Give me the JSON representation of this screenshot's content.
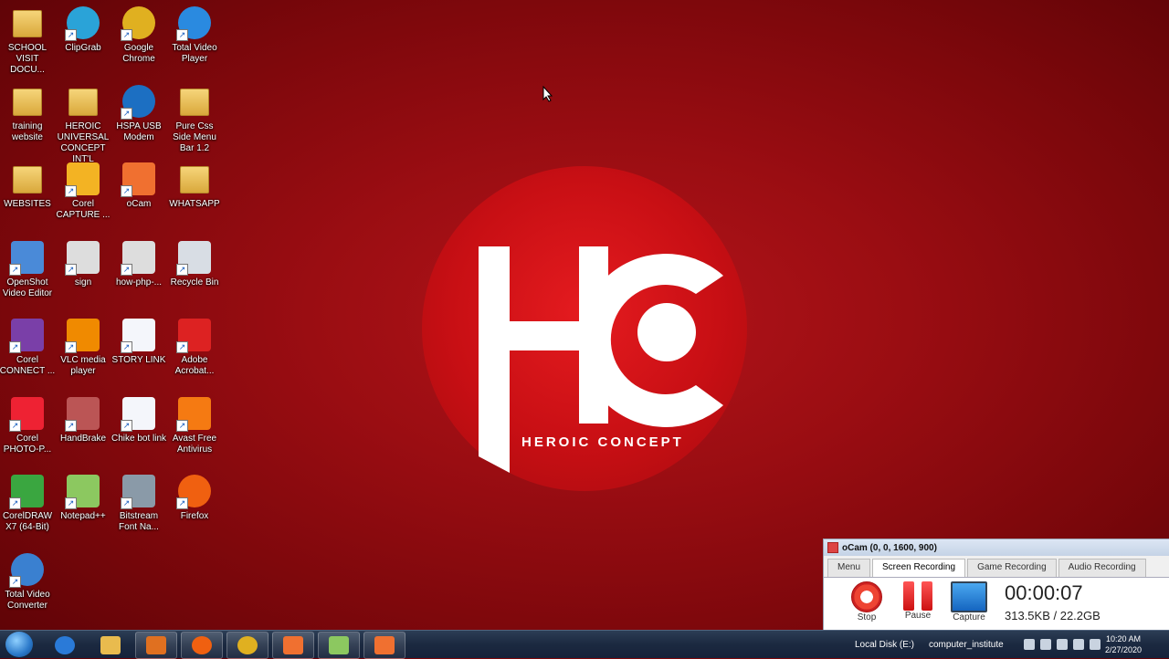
{
  "desktop_icons": [
    {
      "label": "SCHOOL VISIT DOCU...",
      "icon": "folder-icon"
    },
    {
      "label": "ClipGrab",
      "icon": "clipgrab-icon"
    },
    {
      "label": "Google Chrome",
      "icon": "chrome-icon"
    },
    {
      "label": "Total Video Player",
      "icon": "video-player-icon"
    },
    {
      "label": "training website",
      "icon": "folder-icon"
    },
    {
      "label": "HEROIC UNIVERSAL CONCEPT INT'L",
      "icon": "folder-icon"
    },
    {
      "label": "HSPA USB Modem",
      "icon": "globe-icon"
    },
    {
      "label": "Pure Css Side Menu Bar 1.2",
      "icon": "folder-icon"
    },
    {
      "label": "WEBSITES",
      "icon": "folder-icon"
    },
    {
      "label": "Corel CAPTURE ...",
      "icon": "corel-capture-icon"
    },
    {
      "label": "oCam",
      "icon": "ocam-icon"
    },
    {
      "label": "WHATSAPP",
      "icon": "folder-icon"
    },
    {
      "label": "OpenShot Video Editor",
      "icon": "openshot-icon"
    },
    {
      "label": "sign",
      "icon": "image-icon"
    },
    {
      "label": "how-php-...",
      "icon": "image-icon"
    },
    {
      "label": "Recycle Bin",
      "icon": "recycle-bin-icon"
    },
    {
      "label": "Corel CONNECT ...",
      "icon": "corel-connect-icon"
    },
    {
      "label": "VLC media player",
      "icon": "vlc-icon"
    },
    {
      "label": "STORY LINK",
      "icon": "document-icon"
    },
    {
      "label": "Adobe Acrobat...",
      "icon": "acrobat-icon"
    },
    {
      "label": "Corel PHOTO-P...",
      "icon": "corel-photo-icon"
    },
    {
      "label": "HandBrake",
      "icon": "handbrake-icon"
    },
    {
      "label": "Chike bot link",
      "icon": "document-icon"
    },
    {
      "label": "Avast Free Antivirus",
      "icon": "avast-icon"
    },
    {
      "label": "CorelDRAW X7 (64-Bit)",
      "icon": "coreldraw-icon"
    },
    {
      "label": "Notepad++",
      "icon": "notepad-icon"
    },
    {
      "label": "Bitstream Font Na...",
      "icon": "font-icon"
    },
    {
      "label": "Firefox",
      "icon": "firefox-icon"
    },
    {
      "label": "Total Video Converter",
      "icon": "converter-icon"
    }
  ],
  "wallpaper": {
    "brand": "HEROIC CONCEPT",
    "monogram": "HC",
    "bg_color": "#9a0d12",
    "circle_color": "#d41217"
  },
  "ocam": {
    "title": "oCam (0, 0, 1600, 900)",
    "tabs": [
      "Menu",
      "Screen Recording",
      "Game Recording",
      "Audio Recording"
    ],
    "active_tab": "Screen Recording",
    "tools": [
      {
        "label": "Stop",
        "icon": "stop-icon"
      },
      {
        "label": "Pause",
        "icon": "pause-icon"
      },
      {
        "label": "Capture",
        "icon": "monitor-icon"
      }
    ],
    "timer": "00:00:07",
    "size": "313.5KB / 22.2GB"
  },
  "taskbar": {
    "pinned": [
      "internet-explorer-icon",
      "file-explorer-icon",
      "media-player-icon",
      "firefox-icon",
      "chrome-icon",
      "xampp-icon",
      "notepad-icon",
      "ocam-icon"
    ],
    "toolbar_1": "Local Disk (E:)",
    "toolbar_2": "computer_institute",
    "time": "10:20 AM",
    "date": "2/27/2020"
  }
}
